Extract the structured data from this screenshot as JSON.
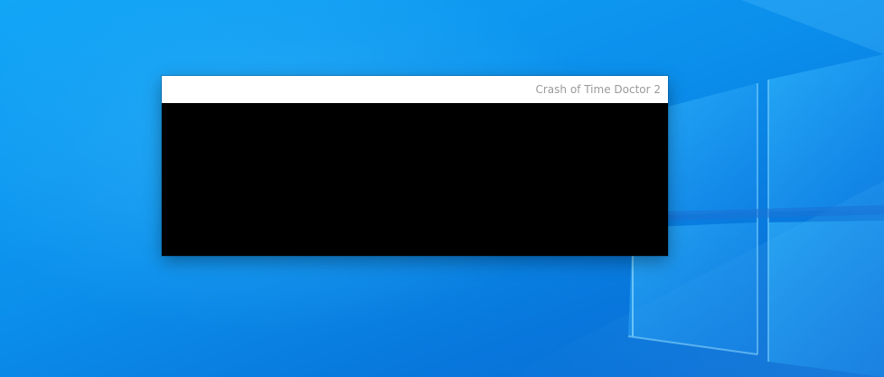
{
  "window": {
    "title": "Crash of Time Doctor 2"
  },
  "colors": {
    "desktop_blue": "#0b8fec",
    "title_bar": "#ffffff",
    "title_text": "#9a9a9a",
    "content": "#000000"
  },
  "icons": [
    "windows-logo-wallpaper"
  ]
}
